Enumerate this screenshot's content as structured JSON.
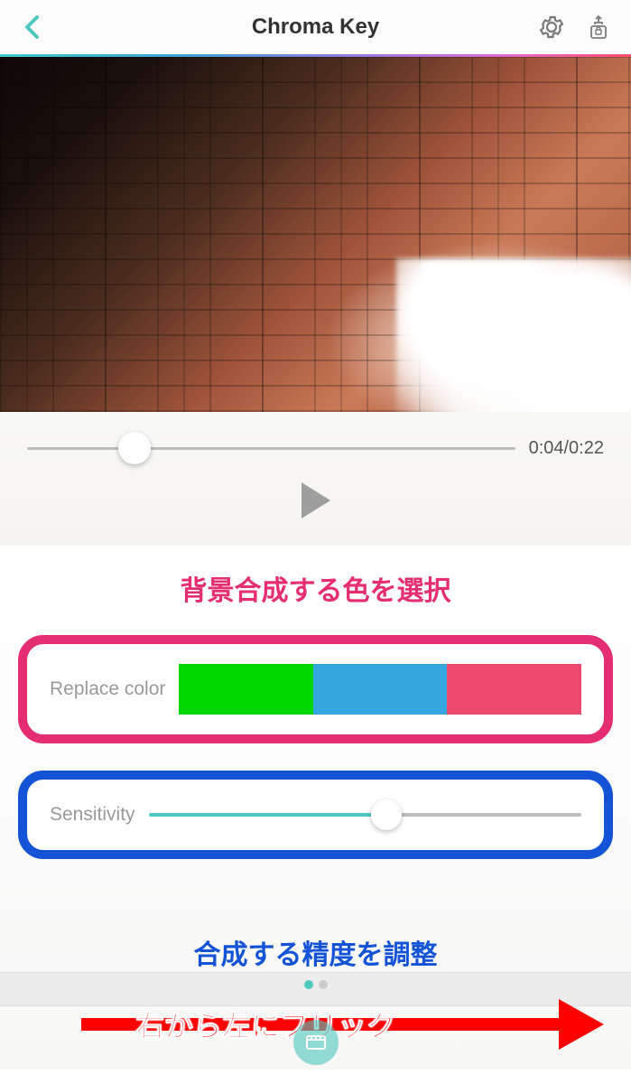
{
  "header": {
    "title": "Chroma Key"
  },
  "player": {
    "time_display": "0:04/0:22",
    "progress_pct": 22
  },
  "annotations": {
    "select_color": "背景合成する色を選択",
    "adjust_precision": "合成する精度を調整",
    "flick_instruction": "右から左にフリック"
  },
  "replace_color": {
    "label": "Replace color",
    "swatches": [
      {
        "name": "green",
        "hex": "#00d600"
      },
      {
        "name": "blue",
        "hex": "#35a6de"
      },
      {
        "name": "pink",
        "hex": "#ed4a6f"
      }
    ]
  },
  "sensitivity": {
    "label": "Sensitivity",
    "value_pct": 55
  },
  "pager": {
    "current": 0,
    "total": 2
  }
}
